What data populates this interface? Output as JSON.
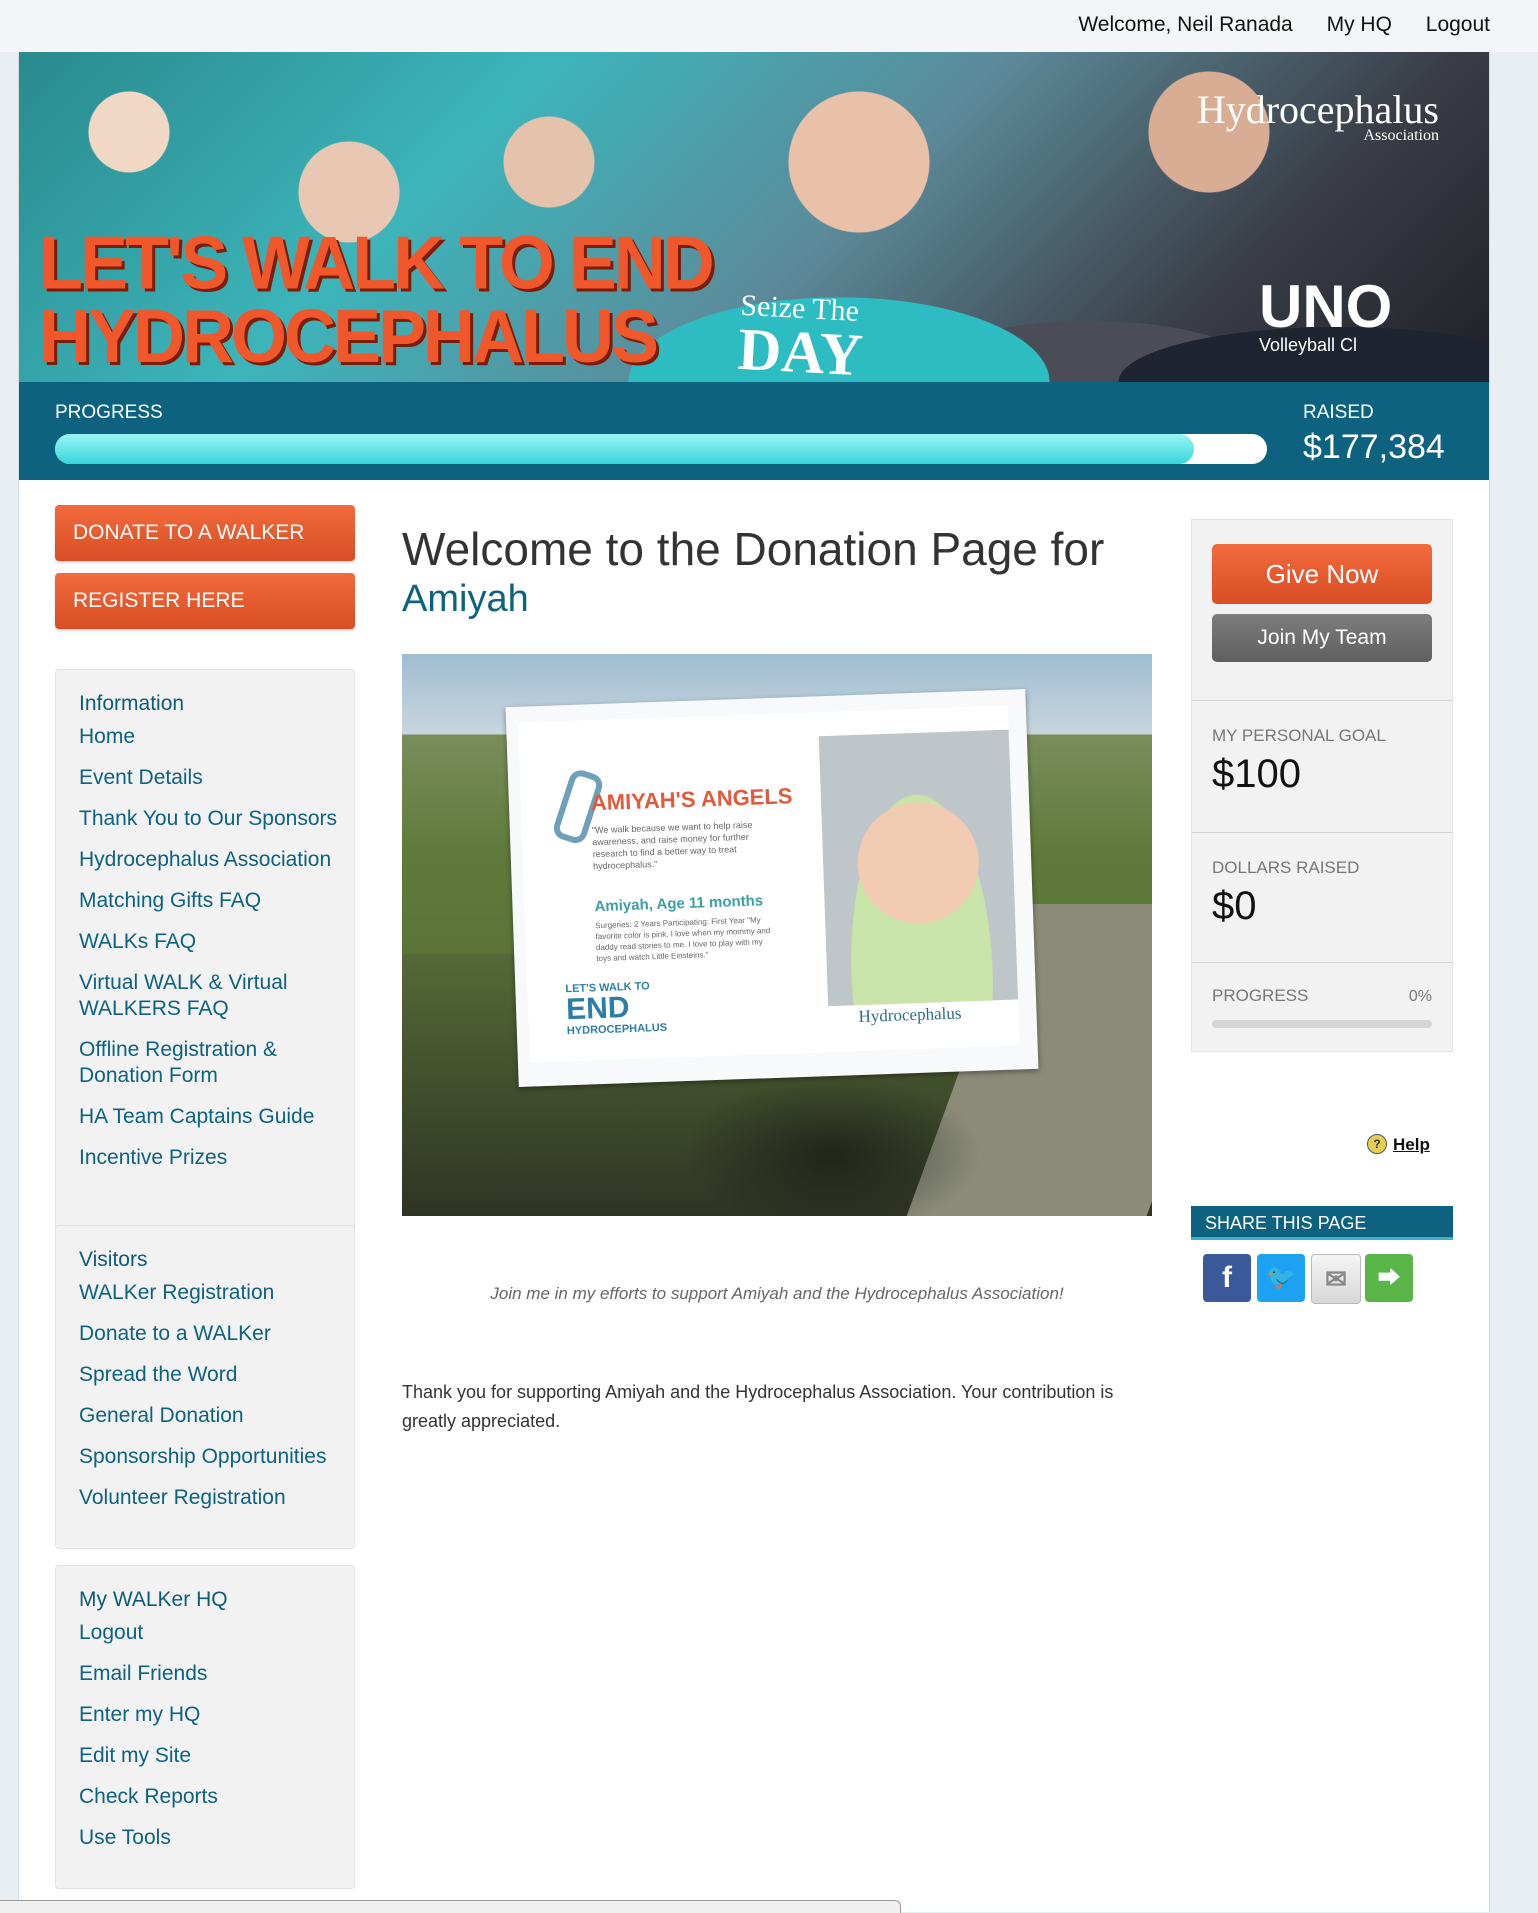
{
  "topbar": {
    "welcome": "Welcome, Neil Ranada",
    "my_hq": "My HQ",
    "logout": "Logout"
  },
  "banner": {
    "headline_line1": "LET'S WALK TO END",
    "headline_line2": "HYDROCEPHALUS",
    "logo_name": "Hydrocephalus",
    "logo_sub": "Association",
    "shirt_line1": "Seize The",
    "shirt_line2": "DAY",
    "uno": "UNO",
    "uno_sub": "Volleyball Cl"
  },
  "progress": {
    "label": "PROGRESS",
    "fraction": 0.94,
    "raised_label": "RAISED",
    "raised_value": "$177,384"
  },
  "left": {
    "donate_button": "DONATE TO A WALKER",
    "register_button": "REGISTER HERE",
    "sections": [
      {
        "heading": "Information",
        "items": [
          "Home",
          "Event Details",
          "Thank You to Our Sponsors",
          "Hydrocephalus Association",
          "Matching Gifts FAQ",
          "WALKs FAQ",
          "Virtual WALK & Virtual WALKERS FAQ",
          "Offline Registration & Donation Form",
          "HA Team Captains Guide",
          "Incentive Prizes"
        ]
      },
      {
        "heading": "Visitors",
        "items": [
          "WALKer Registration",
          "Donate to a WALKer",
          "Spread the Word",
          "General Donation",
          "Sponsorship Opportunities",
          "Volunteer Registration"
        ]
      },
      {
        "heading": "My WALKer HQ",
        "items": [
          "Logout",
          "Email Friends",
          "Enter my HQ",
          "Edit my Site",
          "Check Reports",
          "Use Tools"
        ]
      }
    ]
  },
  "main": {
    "welcome": "Welcome to the Donation Page for",
    "name": "Amiyah",
    "sign_title": "AMIYAH'S ANGELS",
    "sign_quote": "\"We walk because we want to help raise awareness, and raise money for further research to find a better way to treat hydrocephalus.\"",
    "sign_age": "Amiyah, Age 11 months",
    "sign_details": "Surgeries: 2    Years Participating: First Year  \"My favorite color is pink. I love when my mommy and daddy read stories to me. I love to play with my toys and watch Little Einsteins.\"",
    "sign_end_top": "LET'S WALK TO",
    "sign_end": "END",
    "sign_end_bottom": "HYDROCEPHALUS",
    "sign_logo": "Hydrocephalus",
    "caption": "Join me in my efforts to support Amiyah and the Hydrocephalus Association!",
    "thanks": "Thank you for supporting Amiyah and the Hydrocephalus Association. Your contribution is greatly appreciated."
  },
  "right": {
    "give_now": "Give Now",
    "join_team": "Join My Team",
    "goal_label": "MY PERSONAL GOAL",
    "goal_value": "$100",
    "raised_label": "DOLLARS RAISED",
    "raised_value": "$0",
    "progress_label": "PROGRESS",
    "progress_pct": "0%",
    "progress_fraction": 0,
    "help": "Help",
    "share_heading": "SHARE THIS PAGE"
  },
  "share_icons": [
    "facebook-icon",
    "twitter-icon",
    "email-icon",
    "share-icon"
  ]
}
